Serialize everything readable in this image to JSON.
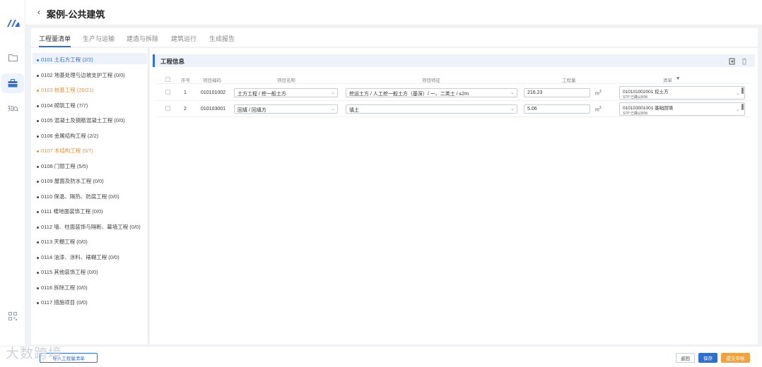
{
  "header": {
    "back_icon": "chevron-left-icon",
    "title": "案例-公共建筑"
  },
  "rail": {
    "icons": [
      "logo-icon",
      "folder-icon",
      "briefcase-icon",
      "knowledge-search-icon",
      "qr-grid-icon"
    ]
  },
  "tabs": [
    {
      "label": "工程量清单",
      "active": true
    },
    {
      "label": "生产与运输",
      "active": false
    },
    {
      "label": "建造与拆除",
      "active": false
    },
    {
      "label": "建筑运行",
      "active": false
    },
    {
      "label": "生成报告",
      "active": false
    }
  ],
  "sidebar": {
    "items": [
      {
        "label": "0101 土石方工程 (2/2)",
        "state": "selected"
      },
      {
        "label": "0102 地基处理与边坡支护工程 (0/0)",
        "state": "normal"
      },
      {
        "label": "0103 桩基工程 (20/21)",
        "state": "warn"
      },
      {
        "label": "0104 砌筑工程 (7/7)",
        "state": "normal"
      },
      {
        "label": "0105 混凝土及钢筋混凝土工程 (0/0)",
        "state": "normal"
      },
      {
        "label": "0106 金属结构工程 (2/2)",
        "state": "normal"
      },
      {
        "label": "0107 木结构工程 (5/7)",
        "state": "warn"
      },
      {
        "label": "0108 门窗工程 (5/5)",
        "state": "normal"
      },
      {
        "label": "0109 屋面及防水工程 (0/0)",
        "state": "normal"
      },
      {
        "label": "0110 保温、隔热、防腐工程 (0/0)",
        "state": "normal"
      },
      {
        "label": "0111 楼地面装饰工程 (0/0)",
        "state": "normal"
      },
      {
        "label": "0112 墙、柱面装饰与隔断、幕墙工程 (0/0)",
        "state": "normal"
      },
      {
        "label": "0113 天棚工程 (0/0)",
        "state": "normal"
      },
      {
        "label": "0114 油漆、涂料、裱糊工程 (0/0)",
        "state": "normal"
      },
      {
        "label": "0115 其他装饰工程 (0/0)",
        "state": "normal"
      },
      {
        "label": "0116 拆除工程 (0/0)",
        "state": "normal"
      },
      {
        "label": "0117 措施项目 (0/0)",
        "state": "normal"
      }
    ]
  },
  "section": {
    "title": "工程信息",
    "icons": [
      "import-icon",
      "delete-icon"
    ]
  },
  "table": {
    "headers": [
      "序号",
      "项目编码",
      "项目名称",
      "项目特征",
      "工程量",
      "清单"
    ],
    "sort_icon": "▼",
    "rows": [
      {
        "seq": "1",
        "code": "010101002",
        "name": "土方工程 / 挖一般土方",
        "feature": "挖运土方 / 人工挖一般土方（基深）/ 一、二类土 / ≤2m",
        "qty": "216.23",
        "unit": "m",
        "unit_sup": "3",
        "list_line1": "010101002001 挖土方",
        "list_line2": "STP 已确认BIM"
      },
      {
        "seq": "2",
        "code": "010103001",
        "name": "回填 / 回填方",
        "feature": "填土",
        "qty": "5.06",
        "unit": "m",
        "unit_sup": "3",
        "list_line1": "010103001001 基础回填",
        "list_line2": "STP 已确认BIM"
      }
    ]
  },
  "footer": {
    "left_button": "导入工程量清单",
    "buttons": [
      "返回",
      "保存",
      "提交审核"
    ],
    "watermark": "大数跨境"
  },
  "colors": {
    "primary": "#2e6fcf",
    "warning": "#e0923c",
    "accent_orange": "#f0a23c"
  }
}
